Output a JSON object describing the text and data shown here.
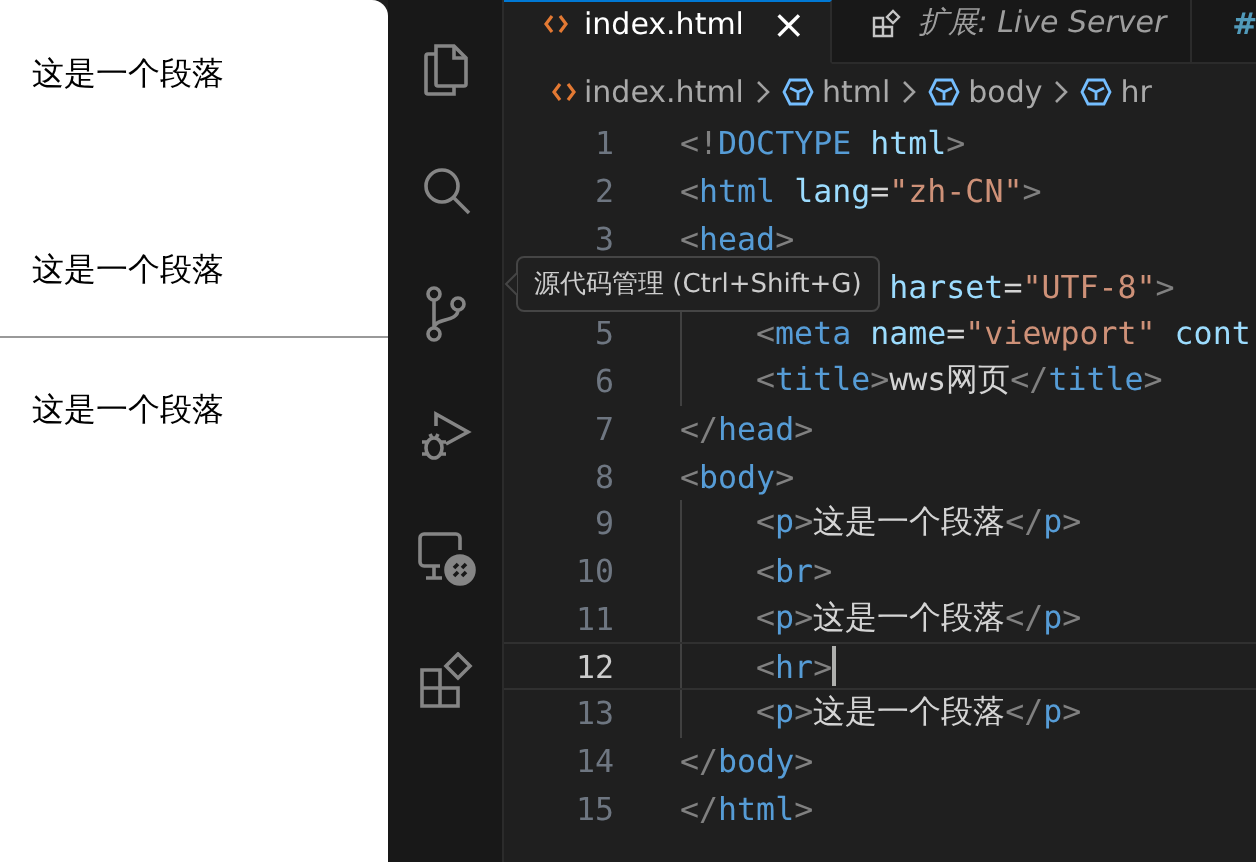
{
  "preview": {
    "blocks": [
      {
        "kind": "p",
        "text": "这是一个段落"
      },
      {
        "kind": "br"
      },
      {
        "kind": "p",
        "text": "这是一个段落"
      },
      {
        "kind": "hr"
      },
      {
        "kind": "p",
        "text": "这是一个段落"
      }
    ]
  },
  "activity_bar": {
    "items": [
      {
        "kind": "files",
        "selected": false
      },
      {
        "kind": "search",
        "selected": false
      },
      {
        "kind": "source-control",
        "selected": false
      },
      {
        "kind": "run-debug",
        "selected": false
      },
      {
        "kind": "remote",
        "selected": false
      },
      {
        "kind": "extensions",
        "selected": false
      }
    ]
  },
  "tabs": [
    {
      "kind": "html",
      "label": "index.html",
      "selected": true,
      "close": "×"
    },
    {
      "kind": "extension",
      "label": "扩展: Live Server",
      "selected": false
    },
    {
      "kind": "css",
      "label": "#",
      "selected": false
    }
  ],
  "breadcrumb": [
    {
      "kind": "file",
      "label": "index.html"
    },
    {
      "kind": "element",
      "label": "html"
    },
    {
      "kind": "element",
      "label": "body"
    },
    {
      "kind": "element",
      "label": "hr"
    }
  ],
  "tooltip": {
    "text": "源代码管理 (Ctrl+Shift+G)"
  },
  "code": [
    {
      "number": "1",
      "indented": false,
      "current": false,
      "code": "<!DOCTYPE html>"
    },
    {
      "number": "2",
      "indented": false,
      "current": false,
      "code": "<html lang=\"zh-CN\">"
    },
    {
      "number": "3",
      "indented": false,
      "current": false,
      "code": "<head>"
    },
    {
      "indented": true,
      "current": false,
      "code": "harset=\"UTF-8\">"
    },
    {
      "number": "5",
      "indented": true,
      "current": false,
      "code": "<meta name=\"viewport\" cont"
    },
    {
      "number": "6",
      "indented": true,
      "current": false,
      "code": "<title>wws网页</title>"
    },
    {
      "number": "7",
      "indented": false,
      "current": false,
      "code": "</head>"
    },
    {
      "number": "8",
      "indented": false,
      "current": false,
      "code": "<body>"
    },
    {
      "number": "9",
      "indented": true,
      "current": false,
      "code": "<p>这是一个段落</p>"
    },
    {
      "number": "10",
      "indented": true,
      "current": false,
      "code": "<br>"
    },
    {
      "number": "11",
      "indented": true,
      "current": false,
      "code": "<p>这是一个段落</p>"
    },
    {
      "number": "12",
      "indented": true,
      "current": true,
      "code": "<hr>"
    },
    {
      "number": "13",
      "indented": true,
      "current": false,
      "code": "<p>这是一个段落</p>"
    },
    {
      "number": "14",
      "indented": false,
      "current": false,
      "code": "</body>"
    },
    {
      "number": "15",
      "indented": false,
      "current": false,
      "code": "</html>"
    }
  ]
}
